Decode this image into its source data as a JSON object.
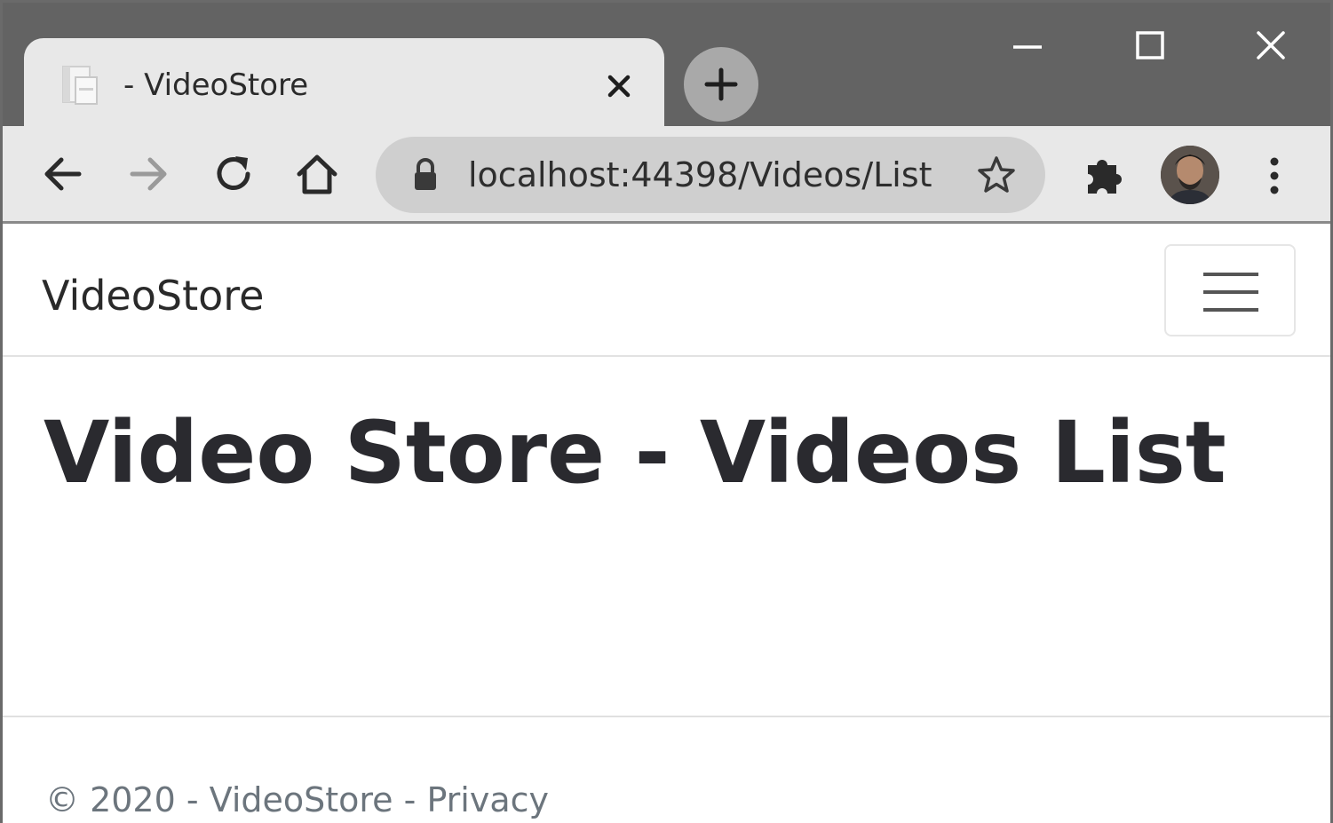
{
  "browser": {
    "tab": {
      "title": "- VideoStore"
    },
    "address_bar": {
      "url": "localhost:44398/Videos/List"
    }
  },
  "app": {
    "brand": "VideoStore",
    "page_title": "Video Store - Videos List"
  },
  "footer": {
    "copyright": "© 2020 - VideoStore - ",
    "privacy_link": "Privacy"
  },
  "icons": {
    "tab_favicon": "page-icon",
    "tab_close": "close-icon",
    "new_tab": "plus-icon",
    "minimize": "minimize-icon",
    "maximize": "maximize-icon",
    "close_window": "close-icon",
    "back": "arrow-left-icon",
    "forward": "arrow-right-icon",
    "reload": "reload-icon",
    "home": "home-icon",
    "lock": "lock-icon",
    "bookmark": "star-icon",
    "extensions": "puzzle-icon",
    "profile": "avatar",
    "menu": "kebab-menu-icon",
    "navbar_toggle": "hamburger-icon"
  },
  "colors": {
    "tabstrip": "#636363",
    "toolbar": "#e8e8e8",
    "omnibox": "#cfcfcf",
    "text_dark": "#2a2a2a",
    "footer_text": "#6c757d"
  }
}
